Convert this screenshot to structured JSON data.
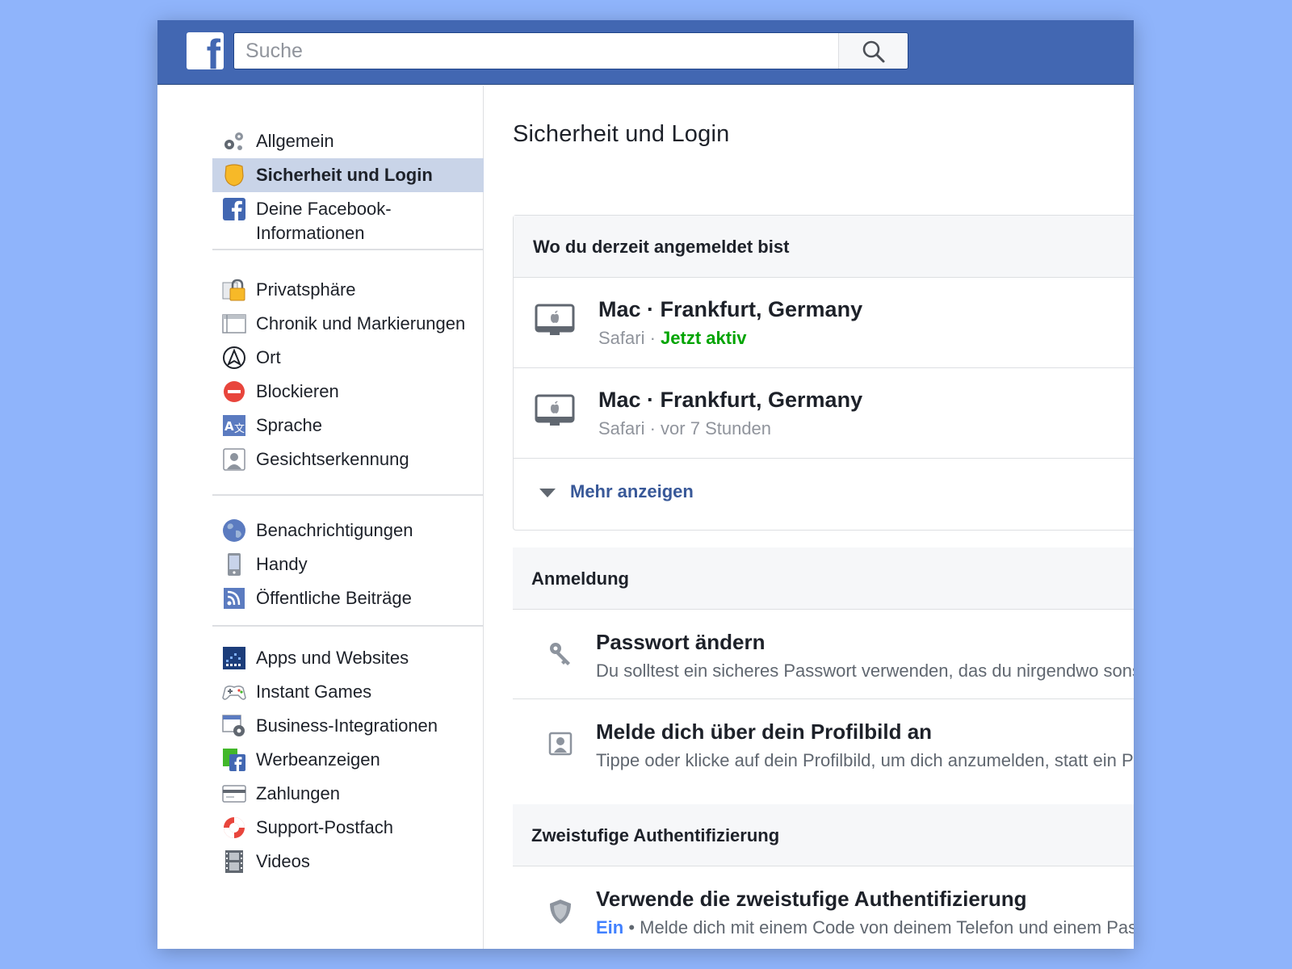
{
  "colors": {
    "background": "#8fb4fb",
    "topbar": "#4267b2",
    "active_green": "#00a400",
    "link_blue": "#385898",
    "status_on_blue": "#4080ff",
    "sidebar_active": "#c9d4e8"
  },
  "header": {
    "logo_letter": "f",
    "search": {
      "placeholder": "Suche",
      "value": "",
      "icon": "search-icon"
    }
  },
  "sidebar": {
    "groups": [
      [
        {
          "label": "Allgemein",
          "icon": "gears-icon"
        },
        {
          "label": "Sicherheit und Login",
          "icon": "badge-icon",
          "active": true
        },
        {
          "label": "Deine Facebook-Informationen",
          "icon": "facebook-icon"
        }
      ],
      [
        {
          "label": "Privatsphäre",
          "icon": "lock-icon"
        },
        {
          "label": "Chronik und Markierungen",
          "icon": "timeline-icon"
        },
        {
          "label": "Ort",
          "icon": "location-icon"
        },
        {
          "label": "Blockieren",
          "icon": "block-icon"
        },
        {
          "label": "Sprache",
          "icon": "language-icon"
        },
        {
          "label": "Gesichtserkennung",
          "icon": "face-icon"
        }
      ],
      [
        {
          "label": "Benachrichtigungen",
          "icon": "globe-icon"
        },
        {
          "label": "Handy",
          "icon": "phone-icon"
        },
        {
          "label": "Öffentliche Beiträge",
          "icon": "rss-icon"
        }
      ],
      [
        {
          "label": "Apps und Websites",
          "icon": "apps-icon"
        },
        {
          "label": "Instant Games",
          "icon": "gamepad-icon"
        },
        {
          "label": "Business-Integrationen",
          "icon": "business-gear-icon"
        },
        {
          "label": "Werbeanzeigen",
          "icon": "ads-icon"
        },
        {
          "label": "Zahlungen",
          "icon": "card-icon"
        },
        {
          "label": "Support-Postfach",
          "icon": "lifebuoy-icon"
        },
        {
          "label": "Videos",
          "icon": "film-icon"
        }
      ]
    ]
  },
  "main": {
    "title": "Sicherheit und Login",
    "sessions": {
      "header": "Wo du derzeit angemeldet bist",
      "items": [
        {
          "device": "Mac · Frankfurt, Germany",
          "browser": "Safari",
          "sep": " · ",
          "status": "Jetzt aktiv"
        },
        {
          "device": "Mac · Frankfurt, Germany",
          "browser": "Safari",
          "sep": " · ",
          "status": "vor 7 Stunden"
        }
      ],
      "more": "Mehr anzeigen"
    },
    "login": {
      "header": "Anmeldung",
      "items": [
        {
          "title": "Passwort ändern",
          "desc": "Du solltest ein sicheres Passwort verwenden, das du nirgendwo sonst verwendest",
          "icon": "key-icon"
        },
        {
          "title": "Melde dich über dein Profilbild an",
          "desc": "Tippe oder klicke auf dein Profilbild, um dich anzumelden, statt ein Passwort zu verwenden",
          "icon": "profile-picture-icon"
        }
      ]
    },
    "two_factor": {
      "header": "Zweistufige Authentifizierung",
      "title": "Verwende die zweistufige Authentifizierung",
      "status": "Ein",
      "bullet": " • ",
      "desc": "Melde dich mit einem Code von deinem Telefon und einem Passwort an",
      "icon": "shield-icon"
    }
  }
}
